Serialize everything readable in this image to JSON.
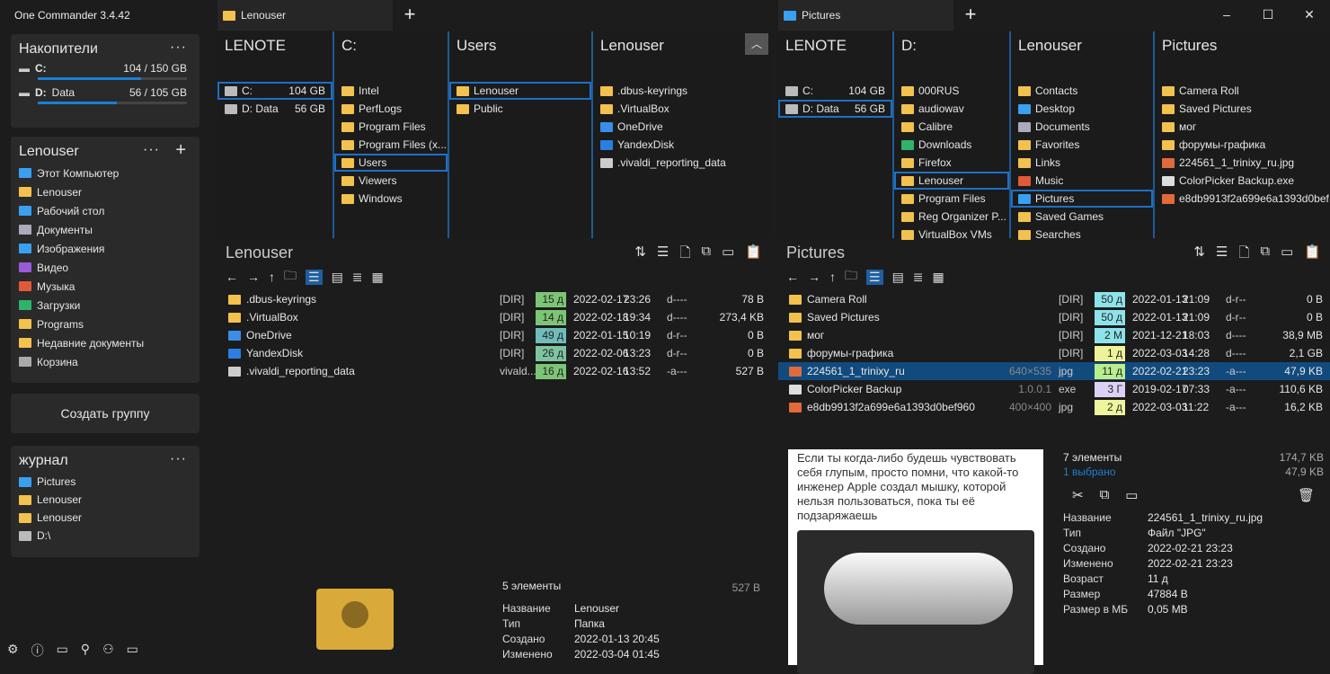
{
  "app": {
    "title": "One Commander 3.4.42"
  },
  "tabs": {
    "left": "Lenouser",
    "right": "Pictures"
  },
  "sidebar": {
    "drives_title": "Накопители",
    "drives": [
      {
        "letter": "C:",
        "label": "",
        "size": "104 / 150 GB",
        "used": 0.69
      },
      {
        "letter": "D:",
        "label": "Data",
        "size": "56 / 105 GB",
        "used": 0.53
      }
    ],
    "user_title": "Lenouser",
    "places": [
      {
        "label": "Этот Компьютер",
        "icon": "computer",
        "color": "#3aa0f0"
      },
      {
        "label": "Lenouser",
        "icon": "folder",
        "color": "#f2c14e"
      },
      {
        "label": "Рабочий стол",
        "icon": "desktop",
        "color": "#3aa0f0"
      },
      {
        "label": "Документы",
        "icon": "documents",
        "color": "#aab"
      },
      {
        "label": "Изображения",
        "icon": "pictures",
        "color": "#3aa0f0"
      },
      {
        "label": "Видео",
        "icon": "video",
        "color": "#9a5ad8"
      },
      {
        "label": "Музыка",
        "icon": "music",
        "color": "#e05a3a"
      },
      {
        "label": "Загрузки",
        "icon": "downloads",
        "color": "#2fb36a"
      },
      {
        "label": "Programs",
        "icon": "folder",
        "color": "#f2c14e"
      },
      {
        "label": "Недавние документы",
        "icon": "recent",
        "color": "#f2c14e"
      },
      {
        "label": "Корзина",
        "icon": "recycle-bin",
        "color": "#aaa"
      }
    ],
    "create_group": "Создать группу",
    "journal_title": "журнал",
    "journal": [
      {
        "label": "Pictures",
        "color": "#3aa0f0"
      },
      {
        "label": "Lenouser",
        "color": "#f2c14e"
      },
      {
        "label": "Lenouser",
        "color": "#f2c14e"
      },
      {
        "label": "D:\\",
        "color": "#bbb"
      }
    ]
  },
  "left": {
    "columns": [
      {
        "title": "LENOTE",
        "items": [
          {
            "label": "C:",
            "extra": "104 GB",
            "sel": true
          },
          {
            "label": "D: Data",
            "extra": "56 GB"
          }
        ]
      },
      {
        "title": "C:",
        "items": [
          {
            "label": "Intel"
          },
          {
            "label": "PerfLogs"
          },
          {
            "label": "Program Files"
          },
          {
            "label": "Program Files (x..."
          },
          {
            "label": "Users",
            "sel": true
          },
          {
            "label": "Viewers"
          },
          {
            "label": "Windows"
          }
        ]
      },
      {
        "title": "Users",
        "items": [
          {
            "label": "Lenouser",
            "sel": true
          },
          {
            "label": "Public"
          }
        ]
      },
      {
        "title": "Lenouser",
        "items": [
          {
            "label": ".dbus-keyrings"
          },
          {
            "label": ".VirtualBox"
          },
          {
            "label": "OneDrive",
            "color": "#3a8ee6"
          },
          {
            "label": "YandexDisk",
            "color": "#2a7fe0"
          },
          {
            "label": ".vivaldi_reporting_data",
            "color": "#ccc"
          }
        ]
      }
    ],
    "header": "Lenouser",
    "files": [
      {
        "name": ".dbus-keyrings",
        "dim": "",
        "ext": "[DIR]",
        "age": "15 д",
        "age_color": "#7cc576",
        "date": "2022-02-17",
        "time": "23:26",
        "attr": "d----",
        "size": "78 B",
        "color": "#f2c14e"
      },
      {
        "name": ".VirtualBox",
        "dim": "",
        "ext": "[DIR]",
        "age": "14 д",
        "age_color": "#7cc576",
        "date": "2022-02-18",
        "time": "19:34",
        "attr": "d----",
        "size": "273,4 KB",
        "color": "#f2c14e"
      },
      {
        "name": "OneDrive",
        "dim": "",
        "ext": "[DIR]",
        "age": "49 д",
        "age_color": "#6fbdbb",
        "date": "2022-01-15",
        "time": "10:19",
        "attr": "d-r--",
        "size": "0 B",
        "color": "#3a8ee6"
      },
      {
        "name": "YandexDisk",
        "dim": "",
        "ext": "[DIR]",
        "age": "26 д",
        "age_color": "#7fc4a0",
        "date": "2022-02-06",
        "time": "13:23",
        "attr": "d-r--",
        "size": "0 B",
        "color": "#2a7fe0"
      },
      {
        "name": ".vivaldi_reporting_data",
        "dim": "",
        "ext": "vivald...",
        "age": "16 д",
        "age_color": "#7cc576",
        "date": "2022-02-16",
        "time": "13:52",
        "attr": "-a---",
        "size": "527 B",
        "color": "#ccc"
      }
    ],
    "summary": {
      "count": "5 элементы",
      "size": "527 B"
    },
    "details": [
      [
        "Название",
        "Lenouser"
      ],
      [
        "Тип",
        "Папка"
      ],
      [
        "Создано",
        "2022-01-13  20:45"
      ],
      [
        "Изменено",
        "2022-03-04  01:45"
      ]
    ]
  },
  "right": {
    "columns": [
      {
        "title": "LENOTE",
        "items": [
          {
            "label": "C:",
            "extra": "104 GB"
          },
          {
            "label": "D: Data",
            "extra": "56 GB",
            "sel": true
          }
        ]
      },
      {
        "title": "D:",
        "items": [
          {
            "label": "000RUS"
          },
          {
            "label": "audiowav"
          },
          {
            "label": "Calibre"
          },
          {
            "label": "Downloads",
            "color": "#2fb36a"
          },
          {
            "label": "Firefox"
          },
          {
            "label": "Lenouser",
            "sel": true
          },
          {
            "label": "Program Files"
          },
          {
            "label": "Reg Organizer P..."
          },
          {
            "label": "VirtualBox VMs"
          }
        ]
      },
      {
        "title": "Lenouser",
        "items": [
          {
            "label": "Contacts"
          },
          {
            "label": "Desktop",
            "color": "#3aa0f0"
          },
          {
            "label": "Documents",
            "color": "#aab"
          },
          {
            "label": "Favorites"
          },
          {
            "label": "Links"
          },
          {
            "label": "Music",
            "color": "#e05a3a"
          },
          {
            "label": "Pictures",
            "color": "#3aa0f0",
            "sel": true
          },
          {
            "label": "Saved Games"
          },
          {
            "label": "Searches"
          }
        ]
      },
      {
        "title": "Pictures",
        "items": [
          {
            "label": "Camera Roll"
          },
          {
            "label": "Saved Pictures"
          },
          {
            "label": "мог"
          },
          {
            "label": "форумы-графика"
          },
          {
            "label": "224561_1_trinixy_ru.jpg",
            "color": "#e06a3a"
          },
          {
            "label": "ColorPicker Backup.exe",
            "color": "#ddd"
          },
          {
            "label": "e8db9913f2a699e6a1393d0bef...",
            "color": "#e06a3a"
          }
        ]
      }
    ],
    "header": "Pictures",
    "files": [
      {
        "name": "Camera Roll",
        "dim": "",
        "ext": "[DIR]",
        "age": "50 д",
        "age_color": "#8de3ea",
        "date": "2022-01-13",
        "time": "21:09",
        "attr": "d-r--",
        "size": "0 B",
        "color": "#f2c14e"
      },
      {
        "name": "Saved Pictures",
        "dim": "",
        "ext": "[DIR]",
        "age": "50 д",
        "age_color": "#8de3ea",
        "date": "2022-01-13",
        "time": "21:09",
        "attr": "d-r--",
        "size": "0 B",
        "color": "#f2c14e"
      },
      {
        "name": "мог",
        "dim": "",
        "ext": "[DIR]",
        "age": "2 М",
        "age_color": "#8de3ea",
        "date": "2021-12-21",
        "time": "18:03",
        "attr": "d----",
        "size": "38,9 MB",
        "color": "#f2c14e"
      },
      {
        "name": "форумы-графика",
        "dim": "",
        "ext": "[DIR]",
        "age": "1 д",
        "age_color": "#eef29a",
        "date": "2022-03-03",
        "time": "14:28",
        "attr": "d----",
        "size": "2,1 GB",
        "color": "#f2c14e"
      },
      {
        "name": "224561_1_trinixy_ru",
        "dim": "640×535",
        "ext": "jpg",
        "age": "11 д",
        "age_color": "#b8ee8c",
        "date": "2022-02-21",
        "time": "23:23",
        "attr": "-a---",
        "size": "47,9 KB",
        "color": "#e06a3a",
        "sel": true
      },
      {
        "name": "ColorPicker Backup",
        "dim": "1.0.0.1",
        "ext": "exe",
        "age": "3 Г",
        "age_color": "#ddd0f5",
        "date": "2019-02-17",
        "time": "07:33",
        "attr": "-a---",
        "size": "110,6 KB",
        "color": "#ddd"
      },
      {
        "name": "e8db9913f2a699e6a1393d0bef960",
        "dim": "400×400",
        "ext": "jpg",
        "age": "2 д",
        "age_color": "#eef59c",
        "date": "2022-03-03",
        "time": "11:22",
        "attr": "-a---",
        "size": "16,2 KB",
        "color": "#e06a3a"
      }
    ],
    "preview_text": "Если ты когда-либо будешь чувствовать себя глупым, просто помни, что какой-то инженер Apple создал мышку, которой нельзя пользоваться, пока ты её подзаряжаешь",
    "summary": {
      "count": "7 элементы",
      "selected": "1 выбрано",
      "total": "174,7 KB",
      "selected_size": "47,9 KB"
    },
    "details": [
      [
        "Название",
        "224561_1_trinixy_ru.jpg"
      ],
      [
        "Тип",
        "Файл \"JPG\""
      ],
      [
        "Создано",
        "2022-02-21  23:23"
      ],
      [
        "Изменено",
        "2022-02-21  23:23"
      ],
      [
        "Возраст",
        "11 д"
      ],
      [
        "Размер",
        "47884 B"
      ],
      [
        "Размер в МБ",
        "0,05 MB"
      ]
    ]
  }
}
